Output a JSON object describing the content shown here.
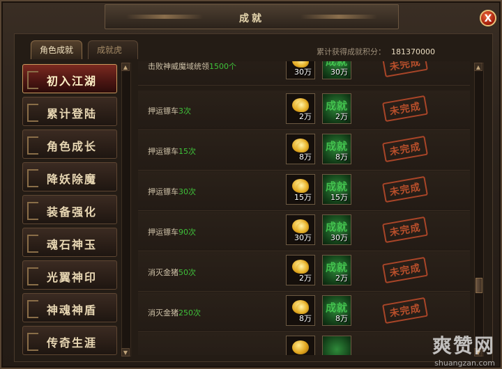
{
  "window": {
    "title": "成就",
    "close_label": "X"
  },
  "tabs": [
    {
      "label": "角色成就",
      "active": true
    },
    {
      "label": "成就虎符",
      "active": false
    }
  ],
  "score": {
    "label": "累计获得成就积分：",
    "value": "181370000"
  },
  "sidebar": {
    "items": [
      {
        "label": "初入江湖",
        "active": true
      },
      {
        "label": "累计登陆",
        "active": false
      },
      {
        "label": "角色成长",
        "active": false
      },
      {
        "label": "降妖除魔",
        "active": false
      },
      {
        "label": "装备强化",
        "active": false
      },
      {
        "label": "魂石神玉",
        "active": false
      },
      {
        "label": "光翼神印",
        "active": false
      },
      {
        "label": "神魂神盾",
        "active": false
      },
      {
        "label": "传奇生涯",
        "active": false
      }
    ]
  },
  "achievements": {
    "rows": [
      {
        "name": "击败神威魔域统领",
        "count": "1500个",
        "gold": "30万",
        "points": "30万",
        "status": "未完成"
      },
      {
        "name": "押运镖车",
        "count": "3次",
        "gold": "2万",
        "points": "2万",
        "status": "未完成"
      },
      {
        "name": "押运镖车",
        "count": "15次",
        "gold": "8万",
        "points": "8万",
        "status": "未完成"
      },
      {
        "name": "押运镖车",
        "count": "30次",
        "gold": "15万",
        "points": "15万",
        "status": "未完成"
      },
      {
        "name": "押运镖车",
        "count": "90次",
        "gold": "30万",
        "points": "30万",
        "status": "未完成"
      },
      {
        "name": "消灭金猪",
        "count": "50次",
        "gold": "2万",
        "points": "2万",
        "status": "未完成"
      },
      {
        "name": "消灭金猪",
        "count": "250次",
        "gold": "8万",
        "points": "8万",
        "status": "未完成"
      },
      {
        "name": "",
        "count": "",
        "gold": "",
        "points": "",
        "status": ""
      }
    ],
    "points_icon_label": "成就"
  },
  "watermark": {
    "big": "爽赞网",
    "small": "shuangzan.com"
  },
  "colors": {
    "accent_green": "#3fc23a",
    "stamp_red": "#c8552e",
    "gold": "#e0a51e"
  }
}
